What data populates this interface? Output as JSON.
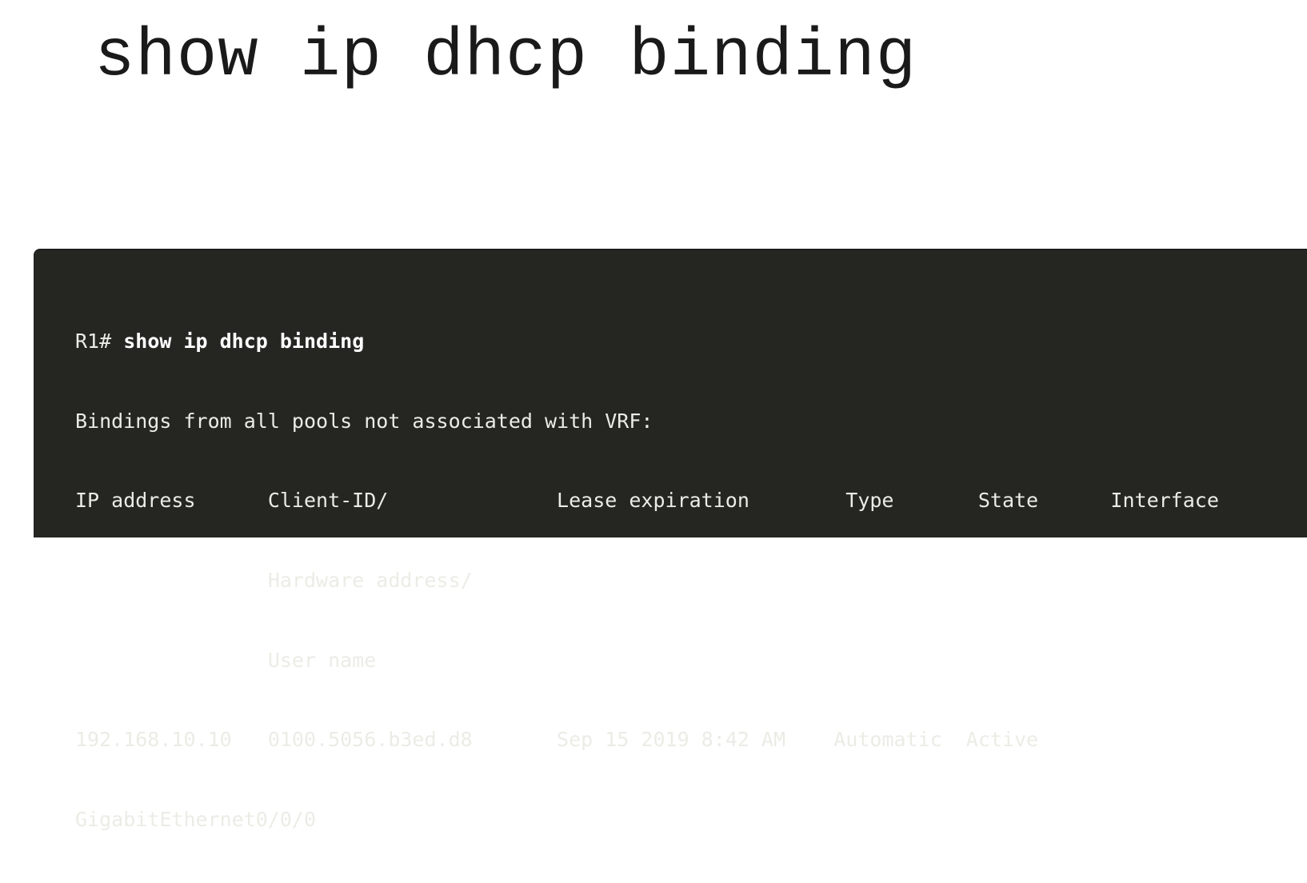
{
  "title": "show ip dhcp binding",
  "terminal": {
    "prompt": "R1#",
    "command": "show ip dhcp binding",
    "lines": [
      "Bindings from all pools not associated with VRF:",
      "IP address      Client-ID/              Lease expiration        Type       State      Interface",
      "                Hardware address/",
      "                User name",
      "192.168.10.10   0100.5056.b3ed.d8       Sep 15 2019 8:42 AM    Automatic  Active",
      "GigabitEthernet0/0/0"
    ]
  }
}
